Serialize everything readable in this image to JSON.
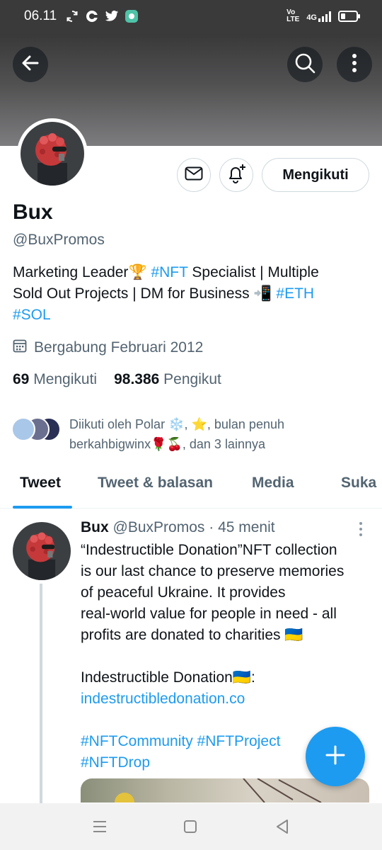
{
  "status_bar": {
    "time": "06.11",
    "volte_top": "Vo",
    "volte_bottom": "LTE",
    "network": "4G"
  },
  "profile": {
    "follow_button": "Mengikuti",
    "display_name": "Bux",
    "handle": "@BuxPromos",
    "bio": {
      "line1_text": "Marketing Leader",
      "line1_emoji": "🏆",
      "line1_tag": "#NFT",
      "line1_rest": " Specialist | Multiple",
      "line2_text": "Sold Out Projects | DM for Business ",
      "line2_emoji": "📲",
      "line2_tag": "#ETH",
      "line3_tag": "#SOL"
    },
    "joined": "Bergabung Februari 2012",
    "following_count": "69",
    "following_label": "Mengikuti",
    "followers_count": "98.386",
    "followers_label": "Pengikut",
    "followed_by_line1": "Diikuti oleh Polar ❄️, ⭐, bulan penuh",
    "followed_by_line2": "berkahbigwinx🌹🍒, dan 3 lainnya"
  },
  "tabs": [
    "Tweet",
    "Tweet & balasan",
    "Media",
    "Suka"
  ],
  "tweet": {
    "name": "Bux",
    "handle": "@BuxPromos",
    "separator": " · ",
    "time": "45 menit",
    "body_line1": "“Indestructible Donation”NFT collection",
    "body_line2": "is our last chance to preserve memories",
    "body_line3": "of peaceful Ukraine. It provides",
    "body_line4": "real-world value for people in need - all",
    "body_line5": "profits are donated to charities 🇺🇦",
    "body_line6": "Indestructible Donation🇺🇦:",
    "link": "indestructibledonation.co",
    "tag1": "#NFTCommunity",
    "tag2": "#NFTProject",
    "tag3": "#NFTDrop"
  },
  "colors": {
    "accent": "#1d9bf0",
    "text": "#0f1419",
    "muted": "#536471"
  },
  "icons": {
    "back": "arrow-left-icon",
    "search": "search-icon",
    "more": "more-vertical-icon",
    "message": "envelope-icon",
    "notify": "bell-plus-icon",
    "calendar": "calendar-icon",
    "compose": "plus-icon",
    "nav_recents": "menu-lines-icon",
    "nav_home": "square-icon",
    "nav_back": "triangle-back-icon"
  }
}
